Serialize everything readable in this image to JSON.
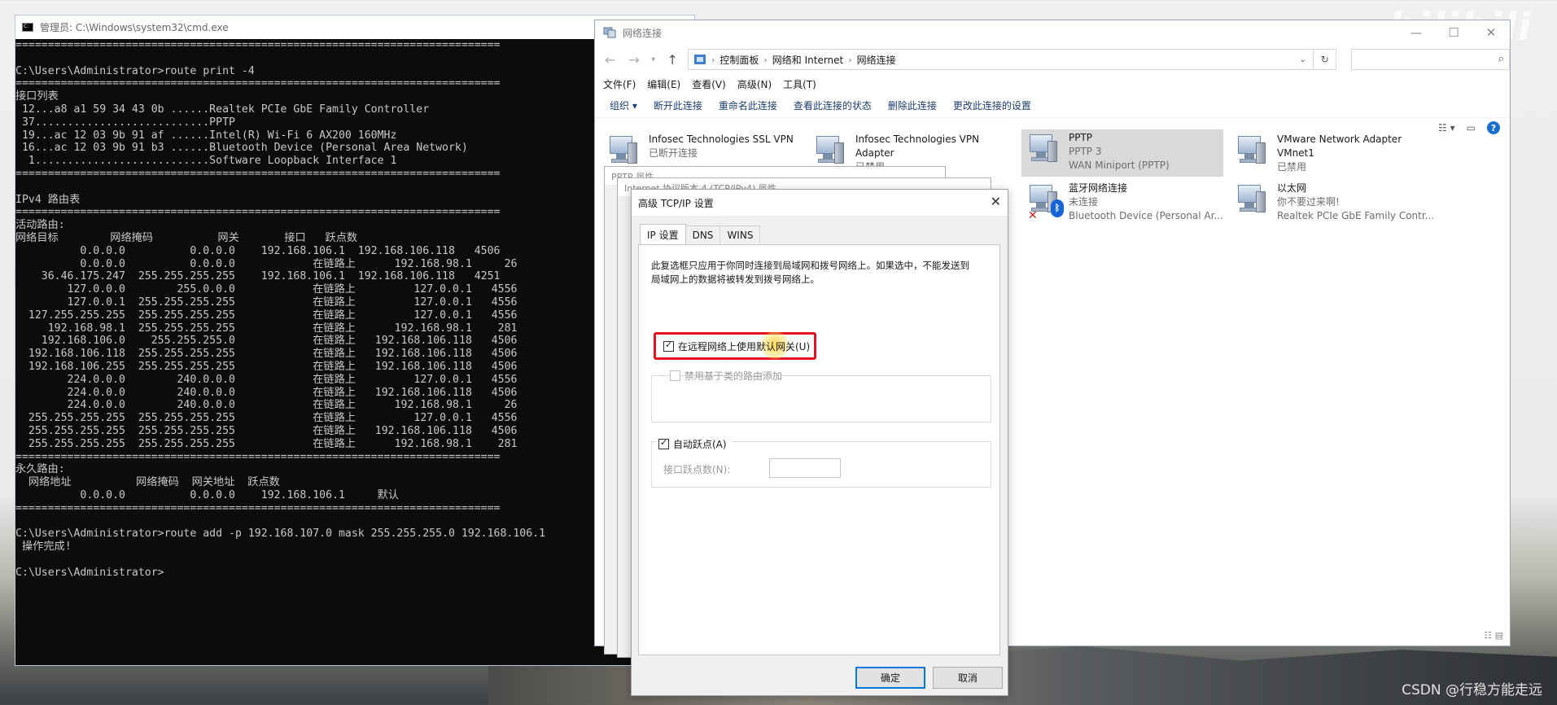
{
  "watermarks": {
    "bilibili": "bilibili",
    "csdn": "CSDN @行稳方能走远"
  },
  "cmd": {
    "title": "管理员: C:\\Windows\\system32\\cmd.exe",
    "lines": [
      "===========================================================================",
      "",
      "C:\\Users\\Administrator>route print -4",
      "===========================================================================",
      "接口列表",
      " 12...a8 a1 59 34 43 0b ......Realtek PCIe GbE Family Controller",
      " 37...........................PPTP",
      " 19...ac 12 03 9b 91 af ......Intel(R) Wi-Fi 6 AX200 160MHz",
      " 16...ac 12 03 9b 91 b3 ......Bluetooth Device (Personal Area Network)",
      "  1...........................Software Loopback Interface 1",
      "===========================================================================",
      "",
      "IPv4 路由表",
      "===========================================================================",
      "活动路由:",
      "网络目标        网络掩码          网关       接口   跃点数",
      "          0.0.0.0          0.0.0.0    192.168.106.1  192.168.106.118   4506",
      "          0.0.0.0          0.0.0.0            在链路上      192.168.98.1     26",
      "    36.46.175.247  255.255.255.255    192.168.106.1  192.168.106.118   4251",
      "        127.0.0.0        255.0.0.0            在链路上         127.0.0.1   4556",
      "        127.0.0.1  255.255.255.255            在链路上         127.0.0.1   4556",
      "  127.255.255.255  255.255.255.255            在链路上         127.0.0.1   4556",
      "     192.168.98.1  255.255.255.255            在链路上      192.168.98.1    281",
      "    192.168.106.0    255.255.255.0            在链路上   192.168.106.118   4506",
      "  192.168.106.118  255.255.255.255            在链路上   192.168.106.118   4506",
      "  192.168.106.255  255.255.255.255            在链路上   192.168.106.118   4506",
      "        224.0.0.0        240.0.0.0            在链路上         127.0.0.1   4556",
      "        224.0.0.0        240.0.0.0            在链路上   192.168.106.118   4506",
      "        224.0.0.0        240.0.0.0            在链路上      192.168.98.1     26",
      "  255.255.255.255  255.255.255.255            在链路上         127.0.0.1   4556",
      "  255.255.255.255  255.255.255.255            在链路上   192.168.106.118   4506",
      "  255.255.255.255  255.255.255.255            在链路上      192.168.98.1    281",
      "===========================================================================",
      "永久路由:",
      "  网络地址          网络掩码  网关地址  跃点数",
      "          0.0.0.0          0.0.0.0    192.168.106.1     默认",
      "===========================================================================",
      "",
      "C:\\Users\\Administrator>route add -p 192.168.107.0 mask 255.255.255.0 192.168.106.1",
      " 操作完成!",
      "",
      "C:\\Users\\Administrator>"
    ]
  },
  "explorer": {
    "title": "网络连接",
    "breadcrumb": [
      "控制面板",
      "网络和 Internet",
      "网络连接"
    ],
    "menu": [
      "文件(F)",
      "编辑(E)",
      "查看(V)",
      "高级(N)",
      "工具(T)"
    ],
    "commands": [
      "组织 ▾",
      "断开此连接",
      "重命名此连接",
      "查看此连接的状态",
      "删除此连接",
      "更改此连接的设置"
    ],
    "connections": [
      {
        "name": "Infosec Technologies SSL VPN",
        "status": "已断开连接",
        "device": ""
      },
      {
        "name": "Infosec Technologies VPN Adapter",
        "status": "已禁用",
        "device": ""
      },
      {
        "name": "PPTP",
        "status": "PPTP 3",
        "device": "WAN Miniport (PPTP)"
      },
      {
        "name": "VMware Network Adapter VMnet1",
        "status": "已禁用",
        "device": ""
      },
      {
        "name": "蓝牙网络连接",
        "status": "未连接",
        "device": "Bluetooth Device (Personal Ar..."
      },
      {
        "name": "以太网",
        "status": "你不要过来啊!",
        "device": "Realtek PCIe GbE Family Contr..."
      }
    ]
  },
  "back_dialogs": {
    "pptp_props": "PPTP 属性",
    "ipv4_props": "Internet 协议版本 4 (TCP/IPv4) 属性"
  },
  "adv_dialog": {
    "title": "高级 TCP/IP 设置",
    "tabs": [
      "IP 设置",
      "DNS",
      "WINS"
    ],
    "description": "此复选框只应用于你同时连接到局域网和拨号网络上。如果选中，不能发送到局域网上的数据将被转发到拨号网络上。",
    "use_default_gateway": "在远程网络上使用默认网关(U)",
    "disable_class_routes": "禁用基于类的路由添加",
    "auto_metric": "自动跃点(A)",
    "interface_metric": "接口跃点数(N):",
    "ok": "确定",
    "cancel": "取消"
  },
  "colors": {
    "highlight": "#e0141e",
    "accent": "#0078d7"
  }
}
